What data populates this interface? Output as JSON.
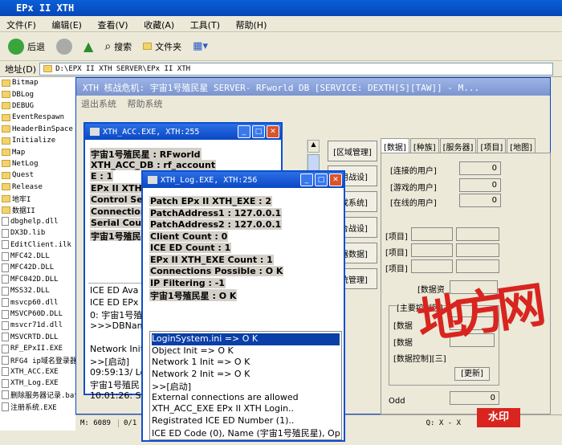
{
  "explorer": {
    "title": "EPx II XTH",
    "menu": [
      "文件(F)",
      "编辑(E)",
      "查看(V)",
      "收藏(A)",
      "工具(T)",
      "帮助(H)"
    ],
    "toolbar": {
      "back": "后退",
      "search": "搜索",
      "folders": "文件夹"
    },
    "address_label": "地址(D)",
    "address": "D:\\EPX II XTH SERVER\\EPx II XTH"
  },
  "files": [
    "Bitmap",
    "DBLog",
    "DEBUG",
    "EventRespawn",
    "HeaderBinSpace",
    "Initialize",
    "Map",
    "NetLog",
    "Quest",
    "Release",
    "地牢I",
    "数据II",
    "dbghelp.dll",
    "DX3D.lib",
    "EditClient.ilk",
    "MFC42.DLL",
    "MFC42D.DLL",
    "MFC042D.DLL",
    "MSS32.DLL",
    "msvcp60.dll",
    "MSVCP60D.DLL",
    "msvcr71d.dll",
    "MSVCRTD.DLL",
    "RF_EPxII.EXE",
    "RFG4 ip域名登录器",
    "XTH_ACC.EXE",
    "XTH_Log.EXE",
    "删除服务器记录.bat",
    "注册系统.EXE"
  ],
  "statusbar": {
    "m": "M: 6089",
    "count": "0/1",
    "q": "Q: X - X"
  },
  "main": {
    "title": "XTH 核战危机: 宇宙1号殖民星 SERVER- RFworld DB [SERVICE: DEXTH[S][TAW]] - M...",
    "menu": [
      "退出系统",
      "帮助系统"
    ],
    "side_buttons": [
      "[区域管理]",
      "[用战设]",
      "[成系统]",
      "[合战设]",
      "[器数据]",
      "[统管理]"
    ],
    "tabs": [
      "[数据]",
      "[种族]",
      "[服务器]",
      "[项目]",
      "[地图]"
    ],
    "rows": [
      {
        "label": "[连接的用户]",
        "value": "0"
      },
      {
        "label": "[游戏的用户]",
        "value": "0"
      },
      {
        "label": "[在线的用户]",
        "value": "0"
      }
    ],
    "item_labels": [
      "[项目]",
      "[项目]",
      "[项目]"
    ],
    "data_label": "[数据资",
    "group_title": "[主要控制区]",
    "ctrl_labels": [
      "[数据",
      "[数据",
      "[数据控制][三]"
    ],
    "refresh": "[更新]",
    "odd": "Odd",
    "odd_value": "0"
  },
  "acc_win": {
    "title": "XTH_ACC.EXE, XTH:255",
    "lines": [
      "宇宙1号殖民星 : RFworld",
      "XTH_ACC_DB : rf_account",
      "E : 1",
      "EPx II XTH_",
      "Control Serv",
      "Connections",
      "Serial Count",
      "宇宙1号殖民"
    ],
    "log": [
      "ICE ED Ava",
      "ICE ED EPx",
      "0: 宇宙1号殖",
      "&gt;&gt;&gt;DBNam",
      "",
      "Network Init",
      "&gt;&gt;[启动]",
      "09:59:13/ Lo",
      "宇宙1号殖民",
      "10:01:26: S"
    ]
  },
  "log_win": {
    "title": "XTH_Log.EXE, XTH:256",
    "lines": [
      "Patch EPx II XTH_EXE : 2",
      "PatchAddress1 : 127.0.0.1",
      "PatchAddress2 : 127.0.0.1",
      "Client Count : 0",
      "ICE ED Count : 1",
      "EPx II XTH_EXE Count : 1",
      "Connections Possible : O K",
      "IP Filtering : -1",
      "宇宙1号殖民星 : O K"
    ],
    "log": [
      "LoginSystem.ini =&gt; O K",
      "Object Init =&gt; O K",
      "Network 1 Init =&gt; O K",
      "Network 2 Init =&gt; O K",
      "&gt;&gt;[启动]",
      "External connections are allowed",
      "XTH_ACC_EXE EPx II XTH Login..",
      "Registrated ICE ED Number (1)..",
      "ICE ED Code (0), Name (宇宙1号殖民星), Op"
    ]
  },
  "watermark": {
    "text": "地方网",
    "badge": "水印"
  },
  "colors": {
    "title_blue": "#0a48c4",
    "watermark_red": "#d8251f"
  }
}
